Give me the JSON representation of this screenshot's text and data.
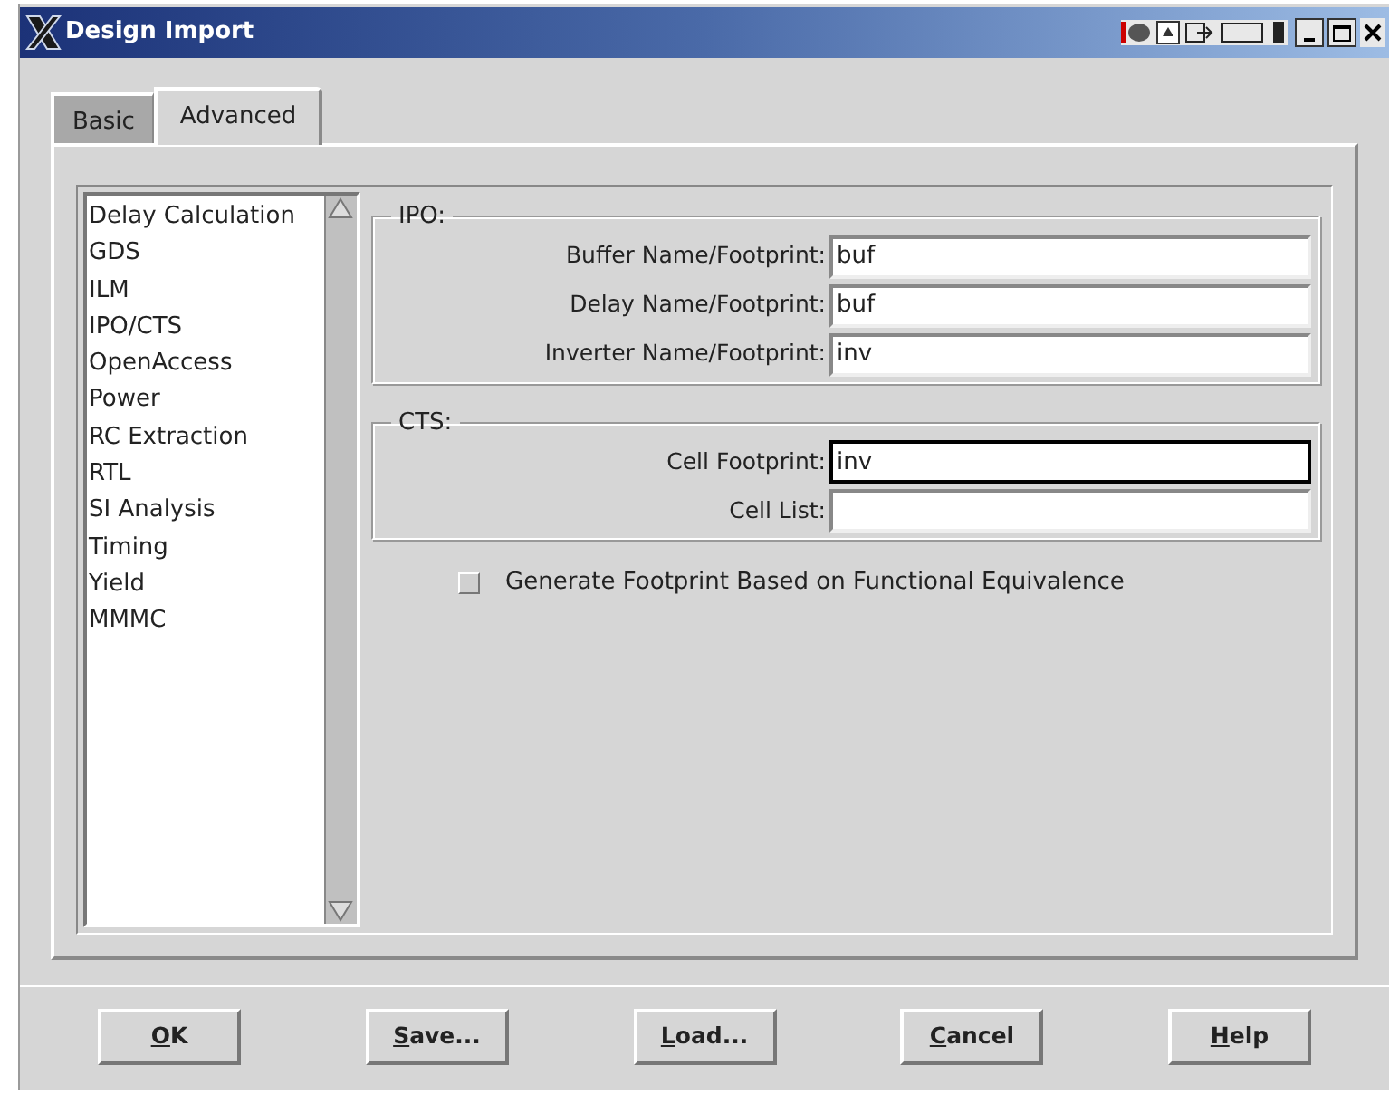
{
  "window": {
    "title": "Design Import"
  },
  "tabs": [
    {
      "label": "Basic",
      "selected": false
    },
    {
      "label": "Advanced",
      "selected": true
    }
  ],
  "categories": [
    {
      "label": "Delay Calculation",
      "selected": false
    },
    {
      "label": "GDS",
      "selected": false
    },
    {
      "label": "ILM",
      "selected": false
    },
    {
      "label": "IPO/CTS",
      "selected": false
    },
    {
      "label": "OpenAccess",
      "selected": false
    },
    {
      "label": "Power",
      "selected": false
    },
    {
      "label": "RC Extraction",
      "selected": false
    },
    {
      "label": "RTL",
      "selected": false
    },
    {
      "label": "SI Analysis",
      "selected": false
    },
    {
      "label": "Timing",
      "selected": false
    },
    {
      "label": "Yield",
      "selected": false
    },
    {
      "label": "MMMC",
      "selected": false
    }
  ],
  "groups": [
    {
      "title": "IPO:",
      "fields": [
        {
          "label": "Buffer Name/Footprint:",
          "value": "buf",
          "focused": false
        },
        {
          "label": "Delay Name/Footprint:",
          "value": "buf",
          "focused": false
        },
        {
          "label": "Inverter Name/Footprint:",
          "value": "inv",
          "focused": false
        }
      ]
    },
    {
      "title": "CTS:",
      "fields": [
        {
          "label": "Cell Footprint:",
          "value": "inv",
          "focused": true
        },
        {
          "label": "Cell List:",
          "focused": false
        }
      ]
    }
  ],
  "checkbox": {
    "label": "Generate Footprint Based on Functional Equivalence",
    "checked": false
  },
  "buttons": [
    {
      "mnemonic": "O",
      "rest": "K"
    },
    {
      "mnemonic": "S",
      "rest": "ave..."
    },
    {
      "mnemonic": "L",
      "rest": "oad..."
    },
    {
      "mnemonic": "C",
      "rest": "ancel"
    },
    {
      "mnemonic": "H",
      "rest": "elp"
    }
  ]
}
